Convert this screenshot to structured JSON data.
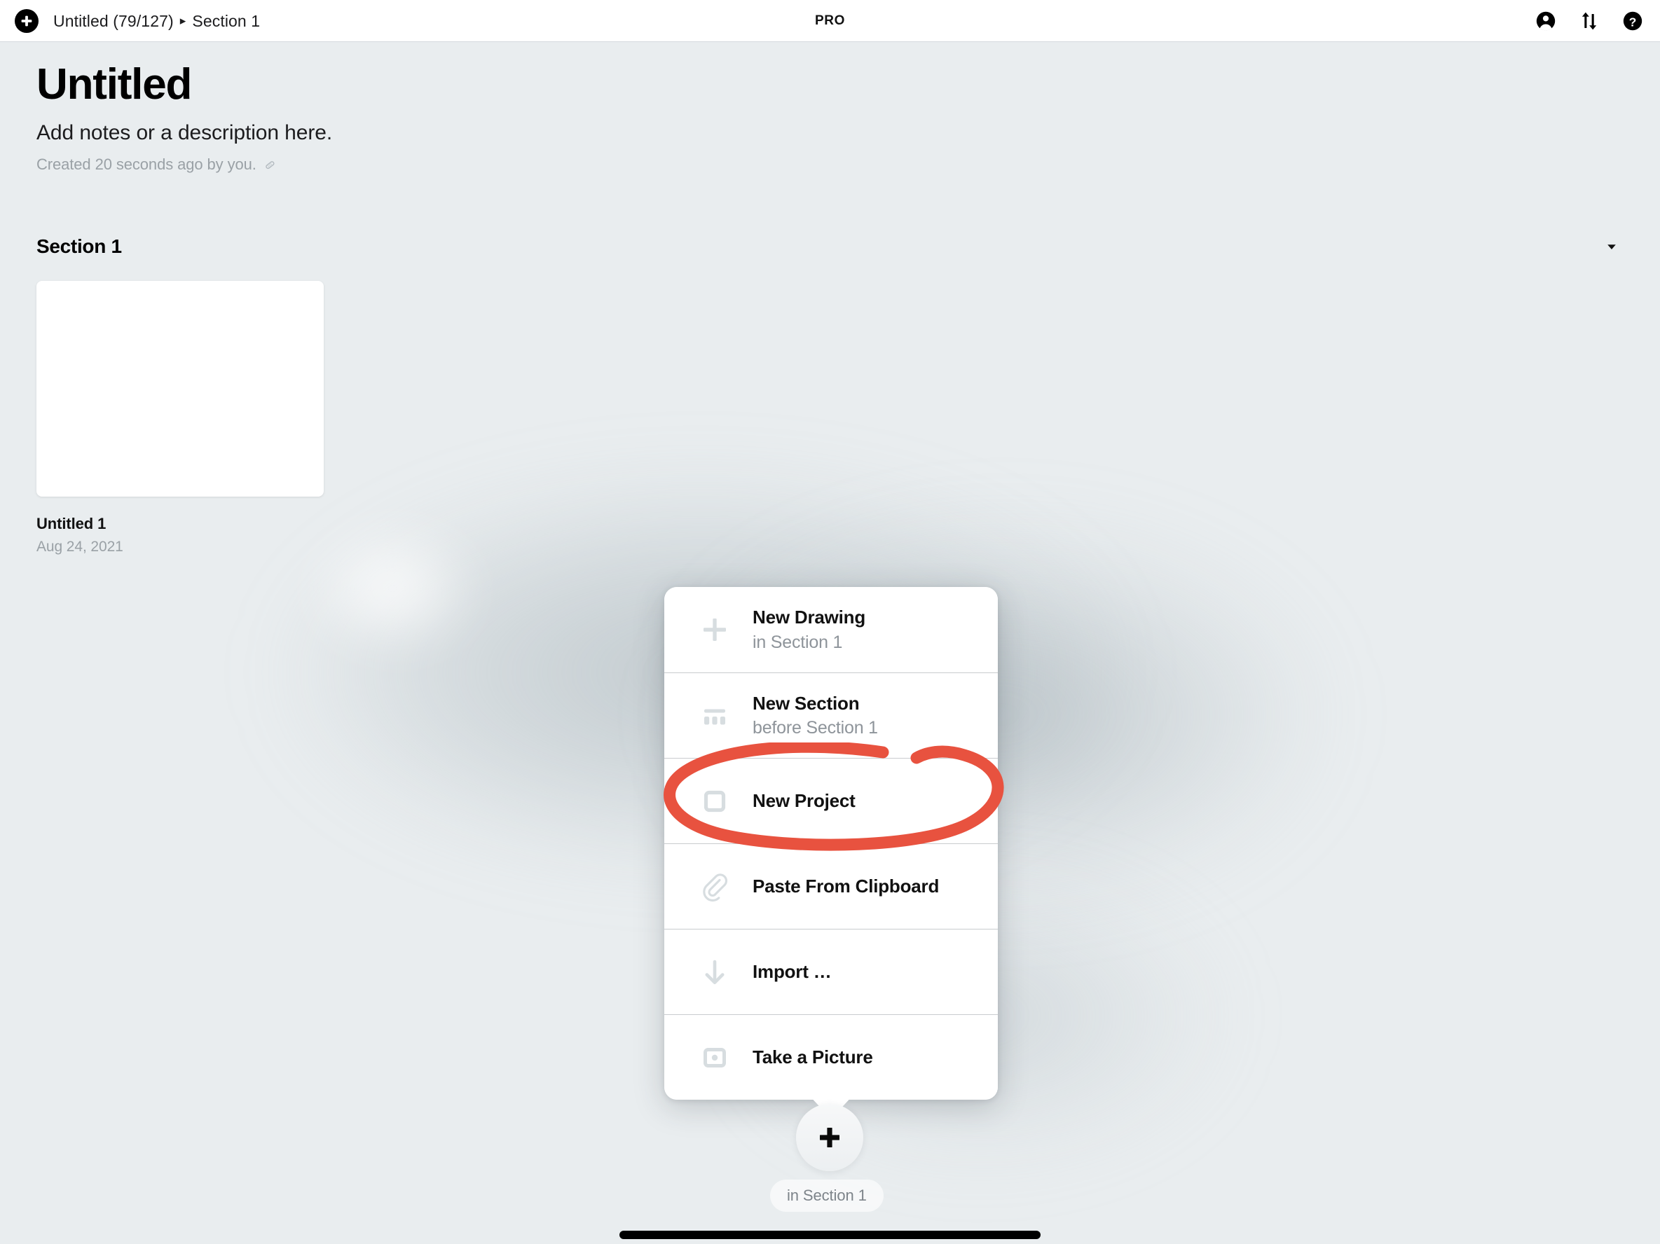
{
  "toolbar": {
    "add_icon": "plus-circle-icon",
    "breadcrumb": {
      "root_label": "Untitled (79/127)",
      "separator": "▸",
      "current_label": "Section 1"
    },
    "pro_badge": "PRO",
    "right_icons": [
      {
        "name": "account-icon",
        "label": "Account"
      },
      {
        "name": "sync-icon",
        "label": "Sync"
      },
      {
        "name": "help-icon",
        "label": "Help"
      }
    ]
  },
  "page": {
    "title": "Untitled",
    "description": "Add notes or a description here.",
    "meta": "Created 20 seconds ago by you.",
    "meta_edit_icon": "pencil-icon"
  },
  "section": {
    "title": "Section 1",
    "menu_icon": "caret-down-icon",
    "cards": [
      {
        "name": "Untitled 1",
        "date": "Aug 24, 2021",
        "thumbnail": "blank-white-canvas"
      }
    ]
  },
  "add_menu": {
    "items": [
      {
        "icon": "plus-icon",
        "label": "New Drawing",
        "sub": "in Section 1"
      },
      {
        "icon": "section-columns-icon",
        "label": "New Section",
        "sub": "before Section 1"
      },
      {
        "icon": "square-outline-icon",
        "label": "New Project",
        "sub": ""
      },
      {
        "icon": "paperclip-icon",
        "label": "Paste From Clipboard",
        "sub": ""
      },
      {
        "icon": "arrow-down-icon",
        "label": "Import …",
        "sub": ""
      },
      {
        "icon": "camera-icon",
        "label": "Take a Picture",
        "sub": ""
      }
    ]
  },
  "fab": {
    "icon": "plus-icon",
    "context_label": "in Section 1"
  },
  "annotation": {
    "type": "hand-drawn-ellipse",
    "target": "New Project",
    "color": "#e8523f"
  },
  "colors": {
    "background": "#e9edef",
    "toolbar_background": "#ffffff",
    "menu_background": "#ffffff",
    "accent_red": "#e8523f",
    "muted_text": "#8e949a",
    "icon_grey": "#d3d9dc"
  }
}
